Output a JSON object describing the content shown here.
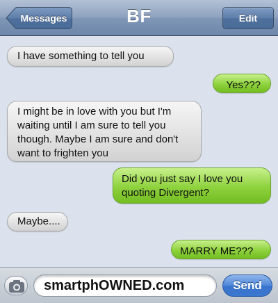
{
  "navbar": {
    "title": "BF",
    "back_label": "Messages",
    "edit_label": "Edit"
  },
  "messages": [
    {
      "direction": "incoming",
      "text": "I have something to tell you"
    },
    {
      "direction": "outgoing",
      "text": "Yes???"
    },
    {
      "direction": "incoming",
      "text": "I might be in love with you but I'm waiting until I am sure to tell you though. Maybe I am sure and don't want to frighten you"
    },
    {
      "direction": "outgoing",
      "text": "Did you just say I love you quoting Divergent?"
    },
    {
      "direction": "incoming",
      "text": "Maybe...."
    },
    {
      "direction": "outgoing",
      "text": "MARRY ME???"
    }
  ],
  "composer": {
    "text": "smartphOWNED.com",
    "send_label": "Send",
    "camera_icon": "camera-icon"
  },
  "colors": {
    "navbar": "#8ea2bf",
    "incoming_bubble": "#e2e2e2",
    "outgoing_bubble": "#8ed23e",
    "send_button": "#4f86d8",
    "background": "#dbe2ed"
  }
}
